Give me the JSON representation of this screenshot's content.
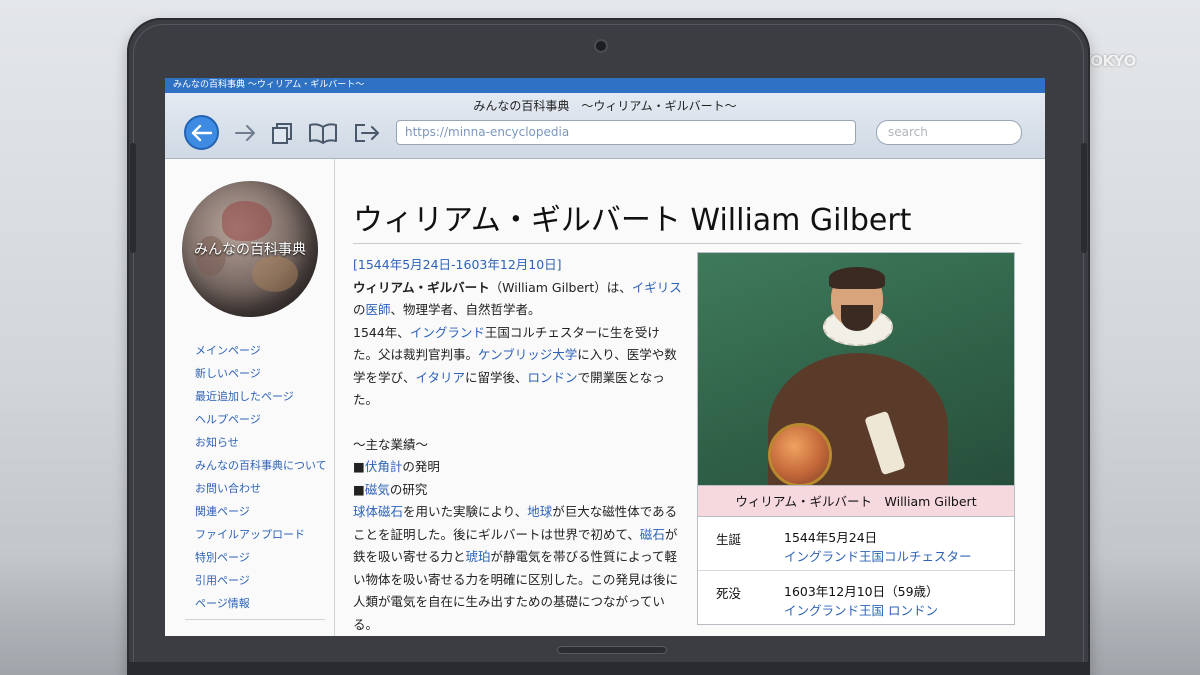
{
  "overlay": {
    "watermark": "TV TOKYO"
  },
  "browser": {
    "tab_title": "みんなの百科事典 〜ウィリアム・ギルバート〜",
    "window_title": "みんなの百科事典　〜ウィリアム・ギルバート〜",
    "url": "https://minna-encyclopedia",
    "search_placeholder": "search",
    "icons": [
      "back-arrow-icon",
      "forward-arrow-icon",
      "copy-pages-icon",
      "book-icon",
      "export-icon"
    ]
  },
  "sidebar": {
    "logo_text": "みんなの百科事典",
    "items": [
      {
        "label": "メインページ"
      },
      {
        "label": "新しいページ"
      },
      {
        "label": "最近追加したページ"
      },
      {
        "label": "ヘルプページ"
      },
      {
        "label": "お知らせ"
      },
      {
        "label": "みんなの百科事典について"
      },
      {
        "label": "お問い合わせ"
      },
      {
        "label": "関連ページ"
      },
      {
        "label": "ファイルアップロード"
      },
      {
        "label": "特別ページ"
      },
      {
        "label": "引用ページ"
      },
      {
        "label": "ページ情報"
      }
    ]
  },
  "article": {
    "title": "ウィリアム・ギルバート William Gilbert",
    "dates": "[1544年5月24日-1603年12月10日]",
    "name_bold": "ウィリアム・ギルバート",
    "name_en": "（William Gilbert）は、",
    "link_england": "イギリス",
    "text_no": "の",
    "link_doctor": "医師",
    "text_roles": "、物理学者、自然哲学者。",
    "text_born": "1544年、",
    "link_england2": "イングランド",
    "text_born2": "王国コルチェスターに生を受けた。父は裁判官判事。",
    "link_cambridge": "ケンブリッジ大学",
    "text_study": "に入り、医学や数学を学び、",
    "link_italy": "イタリア",
    "text_study2": "に留学後、",
    "link_london": "ロンドン",
    "text_study3": "で開業医となった。",
    "achievements_heading": "〜主な業績〜",
    "bullet": "■",
    "link_compass": "伏角計",
    "text_invention": "の発明",
    "link_magnetism": "磁気",
    "text_research": "の研究",
    "link_terrella": "球体磁石",
    "text_p3a": "を用いた実験により、",
    "link_earth": "地球",
    "text_p3b": "が巨大な磁性体であることを証明した。後にギルバートは世界で初めて、",
    "link_magnet": "磁石",
    "text_p3c": "が鉄を吸い寄せる力と",
    "link_amber": "琥珀",
    "text_p3d": "が静電気を帯びる性質によって軽い物体を吸い寄せる力を明確に区別した。この発見は後に人類が電気を自在に生み出すための基礎につながっている。"
  },
  "infobox": {
    "caption": "ウィリアム・ギルバート　William Gilbert",
    "born_label": "生誕",
    "born_date": "1544年5月24日",
    "born_place": "イングランド王国コルチェスター",
    "died_label": "死没",
    "died_date": "1603年12月10日（59歳）",
    "died_place": "イングランド王国 ロンドン"
  }
}
